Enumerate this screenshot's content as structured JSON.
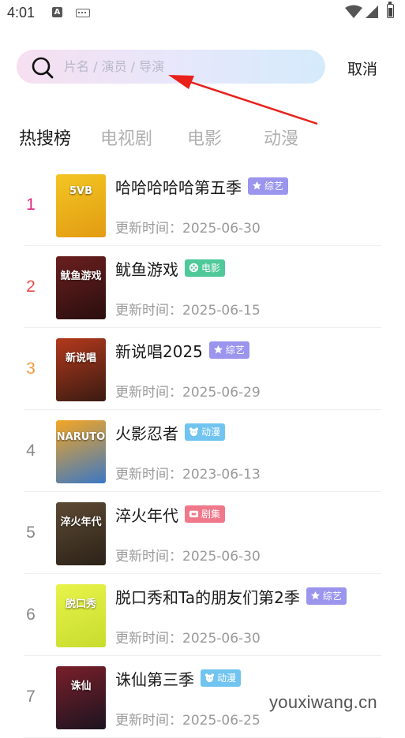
{
  "status_bar": {
    "time": "4:01",
    "a_label": "A"
  },
  "search": {
    "placeholder": "片名 / 演员 / 导演",
    "value": "",
    "cancel_label": "取消"
  },
  "tabs": [
    {
      "label": "热搜榜",
      "active": true
    },
    {
      "label": "电视剧",
      "active": false
    },
    {
      "label": "电影",
      "active": false
    },
    {
      "label": "动漫",
      "active": false
    }
  ],
  "update_prefix": "更新时间：",
  "items": [
    {
      "rank": "1",
      "rank_color": "#e0267f",
      "title": "哈哈哈哈哈第五季",
      "badge": "综艺",
      "badge_color": "#9b95ee",
      "badge_icon": "star-icon",
      "date": "2025-06-30",
      "poster_text": "5VB",
      "poster_colors": [
        "#f3c623",
        "#e29b12"
      ]
    },
    {
      "rank": "2",
      "rank_color": "#ee4a4a",
      "title": "鱿鱼游戏",
      "badge": "电影",
      "badge_color": "#4fc99a",
      "badge_icon": "film-icon",
      "date": "2025-06-15",
      "poster_text": "鱿鱼游戏",
      "poster_colors": [
        "#6b1f1f",
        "#2a0e0e"
      ]
    },
    {
      "rank": "3",
      "rank_color": "#f39a3c",
      "title": "新说唱2025",
      "badge": "综艺",
      "badge_color": "#9b95ee",
      "badge_icon": "star-icon",
      "date": "2025-06-29",
      "poster_text": "新说唱",
      "poster_colors": [
        "#b3391c",
        "#3a1b12"
      ]
    },
    {
      "rank": "4",
      "rank_color": "#888888",
      "title": "火影忍者",
      "badge": "动漫",
      "badge_color": "#71c4f0",
      "badge_icon": "bear-icon",
      "date": "2023-06-13",
      "poster_text": "NARUTO",
      "poster_colors": [
        "#f5a623",
        "#3b78c4"
      ]
    },
    {
      "rank": "5",
      "rank_color": "#888888",
      "title": "淬火年代",
      "badge": "剧集",
      "badge_color": "#f0788b",
      "badge_icon": "tv-icon",
      "date": "2025-06-30",
      "poster_text": "淬火年代",
      "poster_colors": [
        "#5d4a34",
        "#2c2218"
      ]
    },
    {
      "rank": "6",
      "rank_color": "#888888",
      "title": "脱口秀和Ta的朋友们第2季",
      "badge": "综艺",
      "badge_color": "#9b95ee",
      "badge_icon": "star-icon",
      "date": "2025-06-30",
      "poster_text": "脱口秀",
      "poster_colors": [
        "#e8f34a",
        "#c8dc2e"
      ]
    },
    {
      "rank": "7",
      "rank_color": "#888888",
      "title": "诛仙第三季",
      "badge": "动漫",
      "badge_color": "#71c4f0",
      "badge_icon": "bear-icon",
      "date": "2025-06-25",
      "poster_text": "诛仙",
      "poster_colors": [
        "#7a1f2a",
        "#1b1420"
      ]
    }
  ],
  "watermark": "youxiwang.cn"
}
